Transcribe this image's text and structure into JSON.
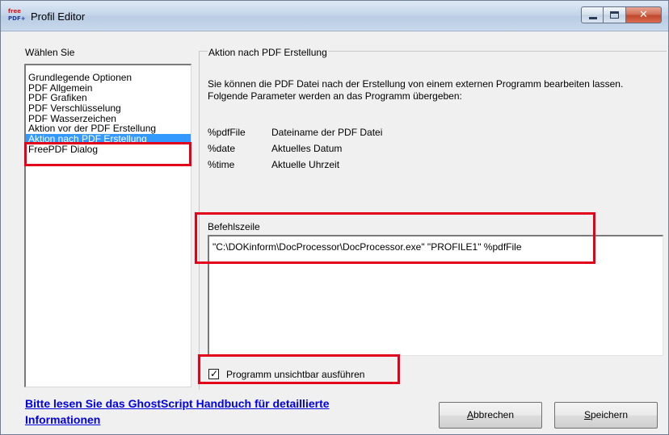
{
  "window": {
    "title": "Profil Editor",
    "icon_text_top": "free",
    "icon_text_bottom": "PDF+"
  },
  "titlebar_buttons": {
    "close_glyph": "✕"
  },
  "sidebar": {
    "heading": "Wählen Sie",
    "items": [
      "Grundlegende Optionen",
      "PDF Allgemein",
      "PDF Grafiken",
      "PDF Verschlüsselung",
      "PDF Wasserzeichen",
      "Aktion vor der PDF Erstellung",
      "Aktion nach PDF Erstellung",
      "FreePDF Dialog"
    ],
    "selected_index": 6
  },
  "panel": {
    "group_title": "Aktion nach PDF Erstellung",
    "description_line1": "Sie können die PDF Datei nach der Erstellung von einem externen Programm bearbeiten lassen.",
    "description_line2": "Folgende Parameter werden an das Programm übergeben:",
    "params": [
      {
        "name": "%pdfFile",
        "desc": "Dateiname der PDF Datei"
      },
      {
        "name": "%date",
        "desc": "Aktuelles Datum"
      },
      {
        "name": "%time",
        "desc": "Aktuelle Uhrzeit"
      }
    ],
    "command_label": "Befehlszeile",
    "command_value": "\"C:\\DOKinform\\DocProcessor\\DocProcessor.exe\" \"PROFILE1\" %pdfFile",
    "checkbox_label": "Programm unsichtbar ausführen",
    "checkbox_checked": true,
    "checkbox_mark": "✓"
  },
  "footer": {
    "link_line1": "Bitte lesen Sie das GhostScript Handbuch für detaillierte",
    "link_line2": "Informationen",
    "cancel_accel": "A",
    "cancel_rest": "bbrechen",
    "save_accel": "S",
    "save_rest": "peichern"
  },
  "colors": {
    "selection": "#3399ff",
    "highlight": "#e2001a",
    "link": "#0000e0"
  }
}
